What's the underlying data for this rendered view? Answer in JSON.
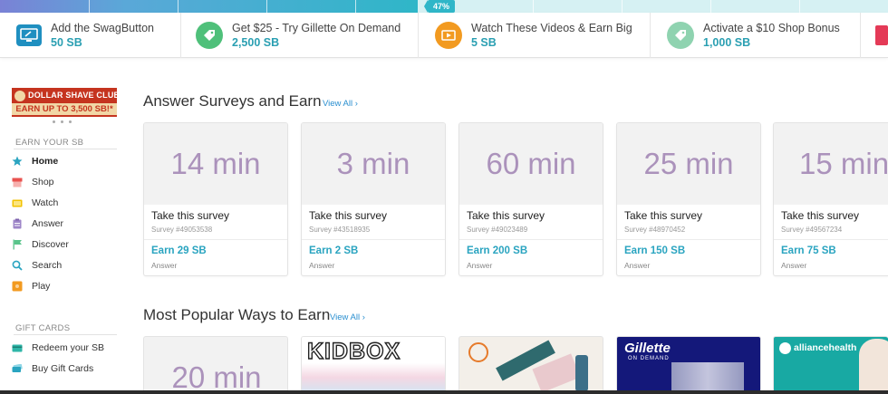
{
  "progress": {
    "percent_label": "47%",
    "fraction": 0.47
  },
  "offers": [
    {
      "title": "Add the SwagButton",
      "reward": "50 SB",
      "icon": "monitor-icon",
      "color": "#1f8fc0"
    },
    {
      "title": "Get $25 - Try Gillette On Demand",
      "reward": "2,500 SB",
      "icon": "tag-icon",
      "color": "#4fc07a"
    },
    {
      "title": "Watch These Videos & Earn Big",
      "reward": "5 SB",
      "icon": "video-icon",
      "color": "#f29a20"
    },
    {
      "title": "Activate a $10 Shop Bonus",
      "reward": "1,000 SB",
      "icon": "tag-icon",
      "color": "#8fd3b0"
    }
  ],
  "promo": {
    "line1": "DOLLAR SHAVE CLUB",
    "line2": "EARN UP TO 3,500 SB!*"
  },
  "sidebar": {
    "earn_title": "EARN YOUR SB",
    "earn_items": [
      {
        "label": "Home",
        "icon": "star-icon",
        "color": "#2aa4c0"
      },
      {
        "label": "Shop",
        "icon": "shop-icon",
        "color": "#e9524f"
      },
      {
        "label": "Watch",
        "icon": "watch-icon",
        "color": "#f2c200"
      },
      {
        "label": "Answer",
        "icon": "clipboard-icon",
        "color": "#9e86c8"
      },
      {
        "label": "Discover",
        "icon": "flag-icon",
        "color": "#58c48a"
      },
      {
        "label": "Search",
        "icon": "search-icon",
        "color": "#2aa4c0"
      },
      {
        "label": "Play",
        "icon": "play-icon",
        "color": "#f29a20"
      }
    ],
    "gift_title": "GIFT CARDS",
    "gift_items": [
      {
        "label": "Redeem your SB",
        "icon": "card-icon",
        "color": "#2fb6a8"
      },
      {
        "label": "Buy Gift Cards",
        "icon": "cards-icon",
        "color": "#2aa4c0"
      }
    ]
  },
  "surveys": {
    "heading": "Answer Surveys and Earn",
    "view_all": "View All",
    "cards": [
      {
        "time": "14 min",
        "title": "Take this survey",
        "id": "Survey #49053538",
        "earn": "Earn 29 SB",
        "category": "Answer"
      },
      {
        "time": "3 min",
        "title": "Take this survey",
        "id": "Survey #43518935",
        "earn": "Earn 2 SB",
        "category": "Answer"
      },
      {
        "time": "60 min",
        "title": "Take this survey",
        "id": "Survey #49023489",
        "earn": "Earn 200 SB",
        "category": "Answer"
      },
      {
        "time": "25 min",
        "title": "Take this survey",
        "id": "Survey #48970452",
        "earn": "Earn 150 SB",
        "category": "Answer"
      },
      {
        "time": "15 min",
        "title": "Take this survey",
        "id": "Survey #49567234",
        "earn": "Earn 75 SB",
        "category": "Answer"
      }
    ]
  },
  "popular": {
    "heading": "Most Popular Ways to Earn",
    "view_all": "View All",
    "cards": [
      {
        "time": "20 min"
      },
      {
        "brand": "KIDBOX"
      },
      {
        "brand": ""
      },
      {
        "brand": "Gillette",
        "sub": "ON DEMAND"
      },
      {
        "brand": "alliancehealth"
      }
    ]
  }
}
